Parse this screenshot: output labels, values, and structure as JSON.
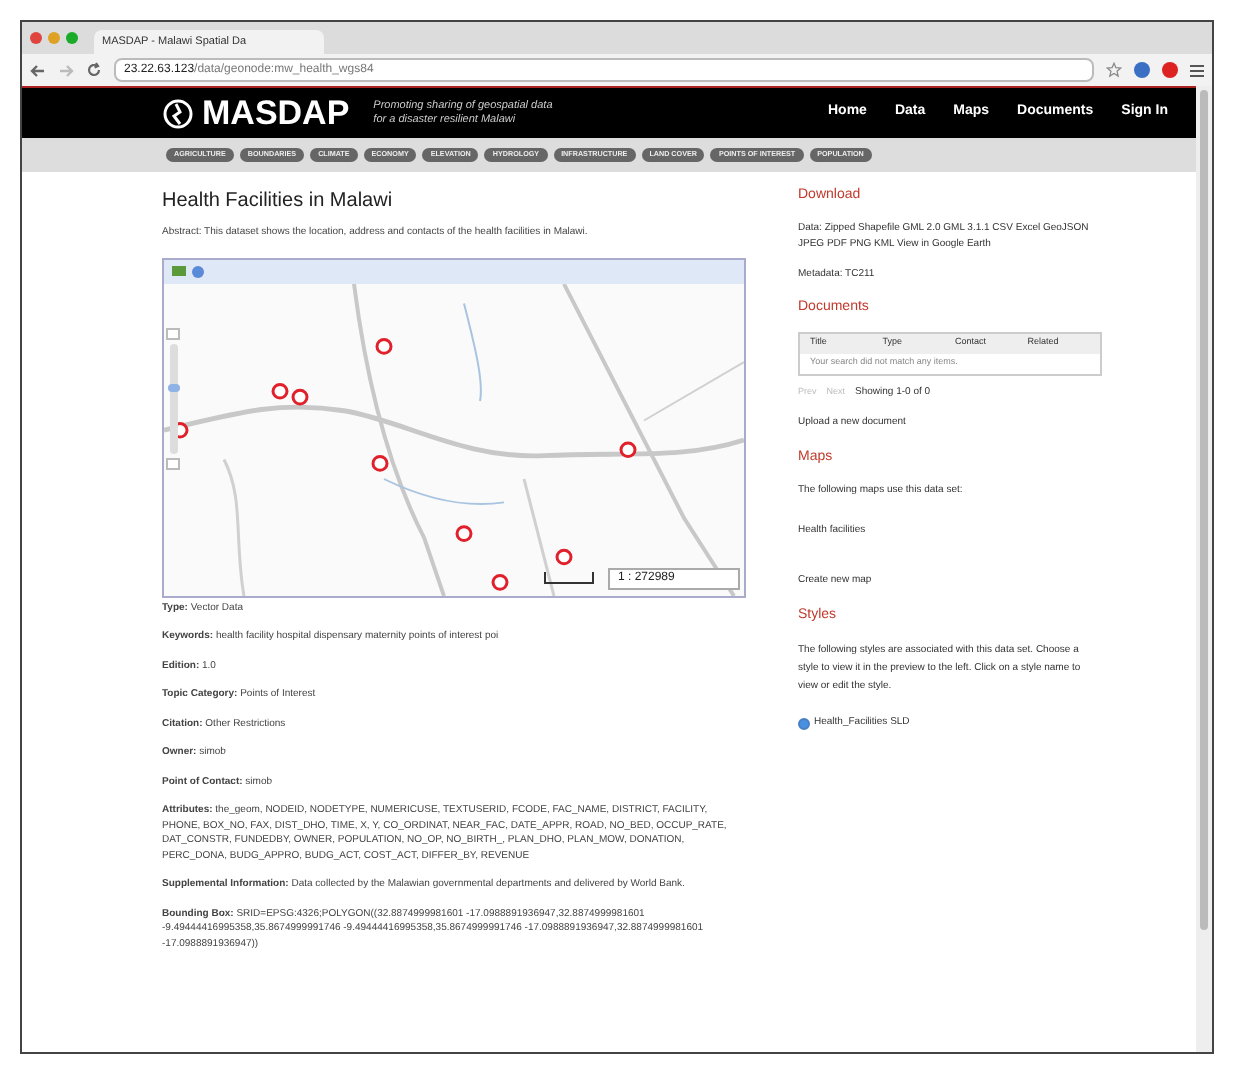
{
  "browser": {
    "tab_title": "MASDAP - Malawi Spatial Da",
    "url_host": "23.22.63.123",
    "url_path": "/data/geonode:mw_health_wgs84"
  },
  "header": {
    "logo": "MASDAP",
    "tagline": [
      "Promoting sharing of geospatial data",
      "for a disaster resilient Malawi"
    ],
    "nav": [
      "Home",
      "Data",
      "Maps",
      "Documents",
      "Sign In"
    ]
  },
  "categories": [
    "AGRICULTURE",
    "BOUNDARIES",
    "CLIMATE",
    "ECONOMY",
    "ELEVATION",
    "HYDROLOGY",
    "INFRASTRUCTURE",
    "LAND COVER",
    "POINTS OF INTEREST",
    "POPULATION"
  ],
  "title": "Health Facilities in Malawi",
  "abstract": "Abstract: This dataset shows the location, address and contacts of the health facilities in Malawi.",
  "map": {
    "scale": "1 : 272989",
    "zoom_slider": {
      "level": 0.6
    }
  },
  "fields": [
    {
      "label": "Type:",
      "value": "Vector Data"
    },
    {
      "label": "Keywords:",
      "value": "health facility hospital dispensary maternity points of interest poi"
    },
    {
      "label": "Edition:",
      "value": "1.0"
    },
    {
      "label": "Topic Category:",
      "value": "Points of Interest"
    },
    {
      "label": "Citation:",
      "value": "Other Restrictions"
    },
    {
      "label": "Owner:",
      "value": "simob"
    },
    {
      "label": "Point of Contact:",
      "value": "simob"
    },
    {
      "label": "Attributes:",
      "value": "the_geom, NODEID, NODETYPE, NUMERICUSE, TEXTUSERID, FCODE, FAC_NAME, DISTRICT, FACILITY, PHONE, BOX_NO, FAX, DIST_DHO, TIME, X, Y, CO_ORDINAT, NEAR_FAC, DATE_APPR, ROAD, NO_BED, OCCUP_RATE, DAT_CONSTR, FUNDEDBY, OWNER, POPULATION, NO_OP, NO_BIRTH_, PLAN_DHO, PLAN_MOW, DONATION, PERC_DONA, BUDG_APPRO, BUDG_ACT, COST_ACT, DIFFER_BY, REVENUE"
    },
    {
      "label": "Supplemental Information:",
      "value": "Data collected by the Malawian governmental departments and delivered by World Bank."
    },
    {
      "label": "Bounding Box:",
      "value": "SRID=EPSG:4326;POLYGON((32.8874999981601 -17.0988891936947,32.8874999981601 -9.49444416995358,35.8674999991746 -9.49444416995358,35.8674999991746 -17.0988891936947,32.8874999981601 -17.0988891936947))"
    }
  ],
  "sidebar": {
    "download_heading": "Download",
    "download_text": "Data: Zipped Shapefile GML 2.0 GML 3.1.1 CSV Excel GeoJSON JPEG PDF PNG KML View in Google Earth",
    "metadata": "Metadata: TC211",
    "documents_heading": "Documents",
    "doc_columns": [
      "Title",
      "Type",
      "Contact",
      "Related"
    ],
    "doc_empty": "Your search did not match any items.",
    "pager": {
      "prev": "Prev",
      "next": "Next",
      "showing": "Showing 1-0 of 0"
    },
    "upload": "Upload a new document",
    "maps_heading": "Maps",
    "maps_text": "The following maps use this data set:",
    "maps": [
      "Health facilities"
    ],
    "create_map": "Create new map",
    "styles_heading": "Styles",
    "styles_text": "The following styles are associated with this data set. Choose a style to view it in the preview to the left. Click on a style name to view or edit the style.",
    "styles": [
      {
        "name": "Health_Facilities SLD",
        "selected": true
      }
    ]
  }
}
